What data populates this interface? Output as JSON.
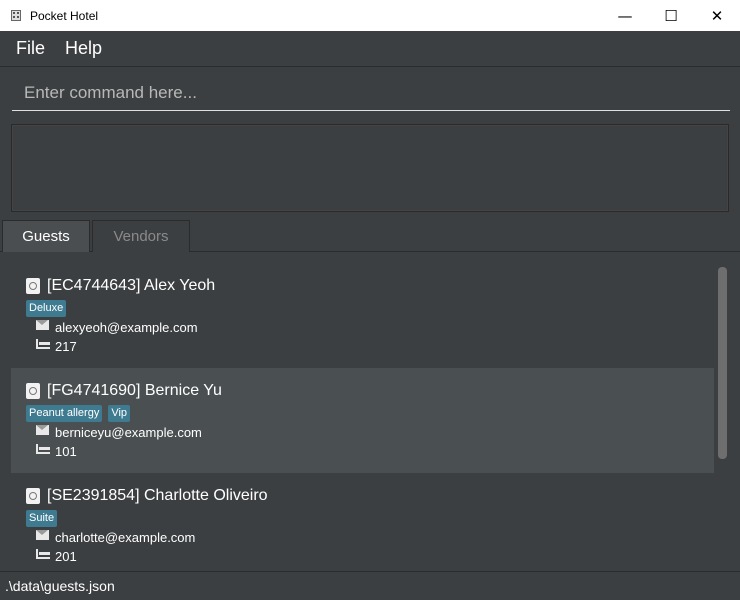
{
  "window": {
    "title": "Pocket Hotel",
    "minimize_glyph": "—",
    "maximize_glyph": "☐",
    "close_glyph": "✕"
  },
  "menu": {
    "items": [
      {
        "label": "File"
      },
      {
        "label": "Help"
      }
    ]
  },
  "command": {
    "placeholder": "Enter command here...",
    "value": ""
  },
  "result": {
    "text": ""
  },
  "tabs": [
    {
      "label": "Guests",
      "active": true
    },
    {
      "label": "Vendors",
      "active": false
    }
  ],
  "guests": [
    {
      "title": "[EC4744643] Alex Yeoh",
      "tags": [
        "Deluxe"
      ],
      "email": "alexyeoh@example.com",
      "room": "217"
    },
    {
      "title": "[FG4741690] Bernice Yu",
      "tags": [
        "Peanut allergy",
        "Vip"
      ],
      "email": "berniceyu@example.com",
      "room": "101"
    },
    {
      "title": "[SE2391854] Charlotte Oliveiro",
      "tags": [
        "Suite"
      ],
      "email": "charlotte@example.com",
      "room": "201"
    }
  ],
  "status": {
    "path": ".\\data\\guests.json"
  },
  "colors": {
    "background": "#3c3f41",
    "tag": "#3e7b91",
    "selected_row": "#4a4f52"
  }
}
